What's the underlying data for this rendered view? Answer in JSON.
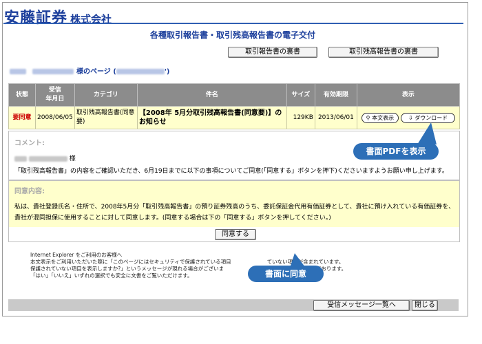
{
  "header": {
    "brand": "安藤証券",
    "brand_sub": "株式会社"
  },
  "page_title": "各種取引報告書・取引残高報告書の電子交付",
  "top_buttons": [
    "取引報告書の裏書",
    "取引残高報告書の裏書"
  ],
  "user_line": {
    "suffix": "様のページ (",
    "close": "')"
  },
  "table": {
    "headers": [
      "状態",
      "受信\n年月日",
      "カテゴリ",
      "件名",
      "サイズ",
      "有効期限",
      "表示"
    ],
    "row": {
      "status": "要同意",
      "date": "2008/06/05",
      "category": "取引残高報告書(同意要)",
      "title": "【2008年 5月分取引残高報告書(同意要)】のお知らせ",
      "size": "129KB",
      "expiry": "2013/06/01",
      "view_btn": "本文表示",
      "download_btn": "ダウンロード"
    }
  },
  "comment": {
    "title": "コメント:",
    "name_suffix": "様",
    "body": "「取引残高報告書」の内容をご確認いただき、6月19日までに以下の事項についてご同意(「同意する」ボタンを押下)くださいますようお願い申し上げます。"
  },
  "agree": {
    "title": "同意内容:",
    "body": "私は、貴社登録氏名・住所で、2008年5月分「取引残高報告書」の預り証券残高のうち、委託保証金代用有価証券として、貴社に預け入れている有価証券を、貴社が混同担保に使用することに対して同意します。(同意する場合は下の「同意する」ボタンを押してください。)",
    "button": "同意する"
  },
  "note_lines": [
    "Internet Explorer をご利用のお客様へ",
    "本文表示をご利用いただいた際に「このページにはセキュリティで保護されている項目",
    "保護されていない項目を表示しますか?」というメッセージが現れる場合がございま",
    "「はい」「いいえ」いずれの選択でも安全に文書をご覧いただけます。"
  ],
  "note_tail": [
    "ていない項目が含まれています。",
    "ております。"
  ],
  "callouts": {
    "pdf": "書面PDFを表示",
    "agree": "書面に同意"
  },
  "footer_buttons": {
    "messages": "受信メッセージ一覧へ",
    "close": "閉じる"
  },
  "colors": {
    "brand": "#1c3f9c",
    "callout": "#2d6fb7",
    "row_bg": "#ffffcc",
    "header_bg": "#8c8c8c",
    "alert": "#cc0000"
  }
}
